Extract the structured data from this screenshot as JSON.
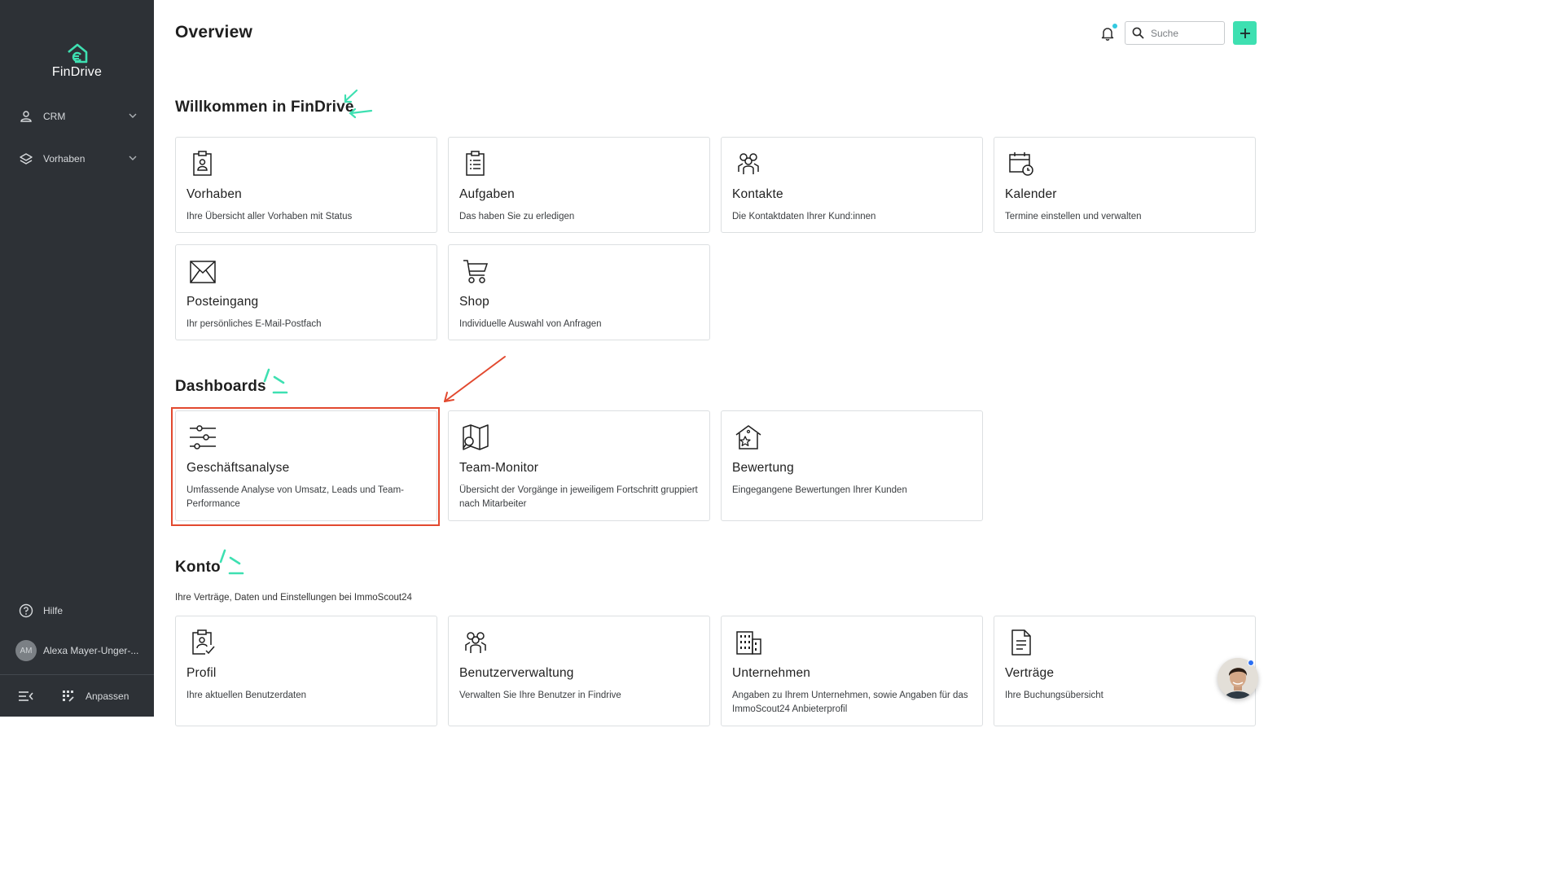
{
  "brand": {
    "name": "FinDrive",
    "accent": "#3ee0b1",
    "annotation_color": "#e2492f"
  },
  "sidebar": {
    "items": [
      {
        "label": "CRM",
        "icon": "person-icon"
      },
      {
        "label": "Vorhaben",
        "icon": "layers-icon"
      }
    ],
    "help_label": "Hilfe",
    "user": {
      "initials": "AM",
      "name": "Alexa Mayer-Unger-..."
    },
    "customize_label": "Anpassen"
  },
  "header": {
    "title": "Overview",
    "search_placeholder": "Suche"
  },
  "sections": {
    "welcome": {
      "title": "Willkommen in FinDrive",
      "cards": [
        {
          "title": "Vorhaben",
          "desc": "Ihre Übersicht aller Vorhaben mit Status"
        },
        {
          "title": "Aufgaben",
          "desc": "Das haben Sie zu erledigen"
        },
        {
          "title": "Kontakte",
          "desc": "Die Kontaktdaten Ihrer Kund:innen"
        },
        {
          "title": "Kalender",
          "desc": "Termine einstellen und verwalten"
        },
        {
          "title": "Posteingang",
          "desc": "Ihr persönliches E-Mail-Postfach"
        },
        {
          "title": "Shop",
          "desc": "Individuelle Auswahl von Anfragen"
        }
      ]
    },
    "dashboards": {
      "title": "Dashboards",
      "cards": [
        {
          "title": "Geschäftsanalyse",
          "desc": "Umfassende Analyse von Umsatz, Leads und Team-Performance"
        },
        {
          "title": "Team-Monitor",
          "desc": "Übersicht der Vorgänge in jeweiligem Fortschritt gruppiert nach Mitarbeiter"
        },
        {
          "title": "Bewertung",
          "desc": "Eingegangene Bewertungen Ihrer Kunden"
        }
      ]
    },
    "konto": {
      "title": "Konto",
      "subtitle": "Ihre Verträge, Daten und Einstellungen bei ImmoScout24",
      "cards": [
        {
          "title": "Profil",
          "desc": "Ihre aktuellen Benutzerdaten"
        },
        {
          "title": "Benutzerverwaltung",
          "desc": "Verwalten Sie Ihre Benutzer in Findrive"
        },
        {
          "title": "Unternehmen",
          "desc": "Angaben zu Ihrem Unternehmen, sowie Angaben für das ImmoScout24 Anbieterprofil"
        },
        {
          "title": "Verträge",
          "desc": "Ihre Buchungsübersicht"
        }
      ]
    }
  }
}
